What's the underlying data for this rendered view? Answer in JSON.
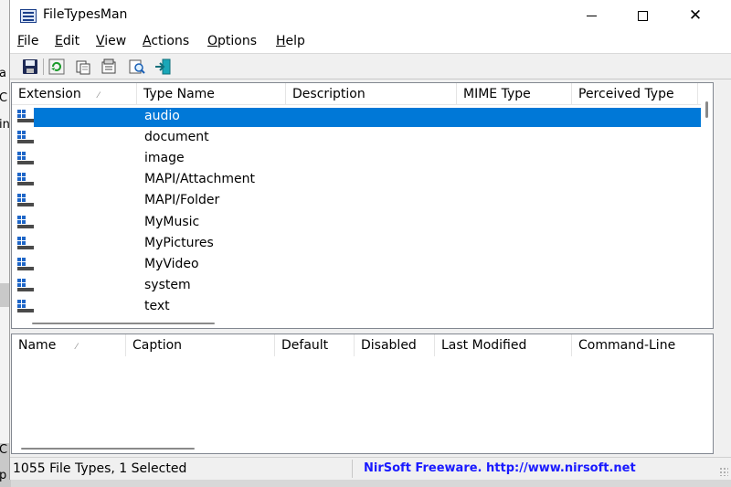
{
  "window": {
    "title": "FileTypesMan",
    "controls": {
      "minimize": "minimize",
      "maximize": "maximize",
      "close": "✕"
    }
  },
  "menu": [
    {
      "label": "File",
      "accel": "F",
      "rest": "ile"
    },
    {
      "label": "Edit",
      "accel": "E",
      "rest": "dit"
    },
    {
      "label": "View",
      "accel": "V",
      "rest": "iew"
    },
    {
      "label": "Actions",
      "accel": "A",
      "rest": "ctions"
    },
    {
      "label": "Options",
      "accel": "O",
      "rest": "ptions"
    },
    {
      "label": "Help",
      "accel": "H",
      "rest": "elp"
    }
  ],
  "toolbar": {
    "buttons": [
      "save-icon",
      "refresh-icon",
      "copy-icon",
      "properties-icon",
      "find-icon",
      "exit-icon"
    ]
  },
  "top_table": {
    "columns": [
      "Extension",
      "Type Name",
      "Description",
      "MIME Type",
      "Perceived Type"
    ],
    "rows": [
      {
        "type_name": "audio",
        "selected": true
      },
      {
        "type_name": "document",
        "selected": false
      },
      {
        "type_name": "image",
        "selected": false
      },
      {
        "type_name": "MAPI/Attachment",
        "selected": false
      },
      {
        "type_name": "MAPI/Folder",
        "selected": false
      },
      {
        "type_name": "MyMusic",
        "selected": false
      },
      {
        "type_name": "MyPictures",
        "selected": false
      },
      {
        "type_name": "MyVideo",
        "selected": false
      },
      {
        "type_name": "system",
        "selected": false
      },
      {
        "type_name": "text",
        "selected": false
      }
    ]
  },
  "bottom_table": {
    "columns": [
      "Name",
      "Caption",
      "Default",
      "Disabled",
      "Last Modified",
      "Command-Line"
    ]
  },
  "status": {
    "left": "1055 File Types, 1 Selected",
    "right": "NirSoft Freeware.  http://www.nirsoft.net"
  },
  "background_fragments": [
    "a",
    "C",
    "in",
    "C",
    "p"
  ],
  "colors": {
    "selection": "#0078d7",
    "nirsoft_link": "#1a1aff"
  }
}
